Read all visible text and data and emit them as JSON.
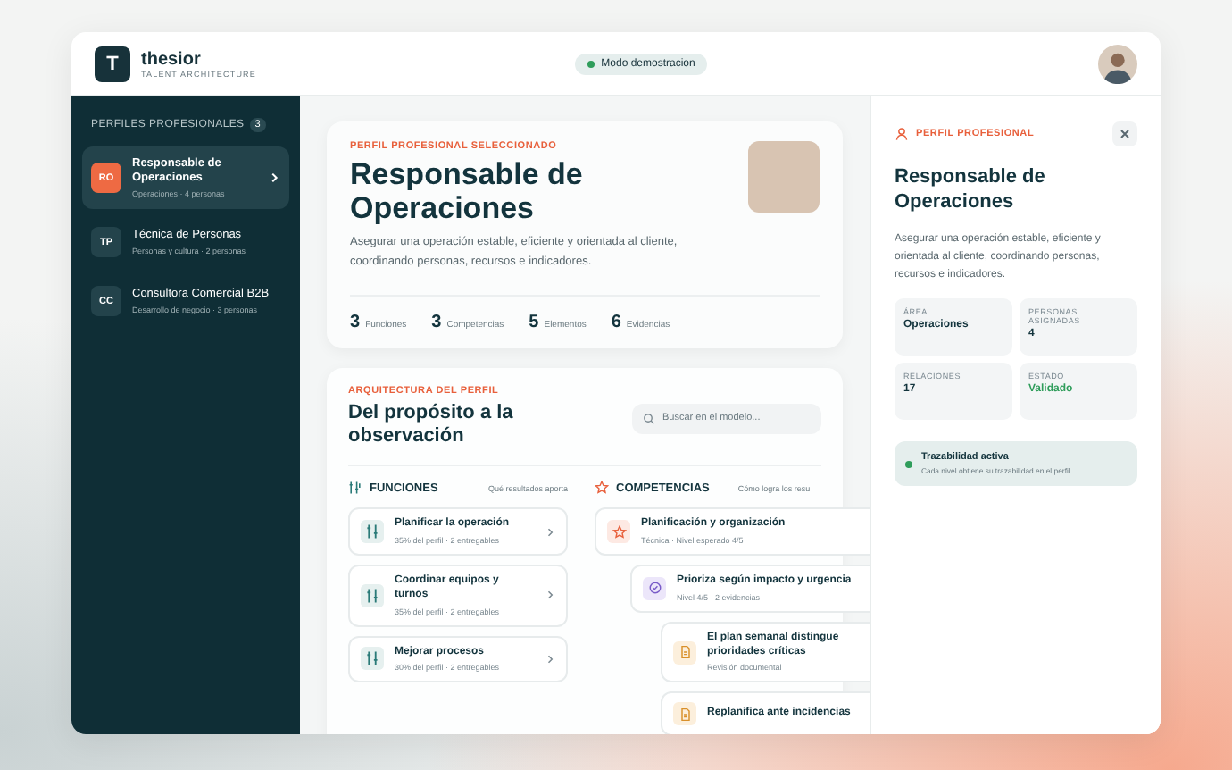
{
  "brand": {
    "logo_letter": "T",
    "name": "thesior",
    "tagline": "TALENT ARCHITECTURE"
  },
  "mode_badge": "Modo demostracion",
  "sidebar": {
    "heading": "PERFILES PROFESIONALES",
    "count": "3",
    "items": [
      {
        "initials": "RO",
        "title": "Responsable de Operaciones",
        "meta": "Operaciones · 4 personas",
        "selected": true
      },
      {
        "initials": "TP",
        "title": "Técnica de Personas",
        "meta": "Personas y cultura · 2 personas",
        "selected": false
      },
      {
        "initials": "CC",
        "title": "Consultora Comercial B2B",
        "meta": "Desarrollo de negocio · 3 personas",
        "selected": false
      }
    ]
  },
  "profile_card": {
    "eyebrow": "PERFIL PROFESIONAL SELECCIONADO",
    "title": "Responsable de Operaciones",
    "description": "Asegurar una operación estable, eficiente y orientada al cliente, coordinando personas, recursos e indicadores.",
    "stats": [
      {
        "value": "3",
        "label": "Funciones"
      },
      {
        "value": "3",
        "label": "Competencias"
      },
      {
        "value": "5",
        "label": "Elementos"
      },
      {
        "value": "6",
        "label": "Evidencias"
      }
    ]
  },
  "architecture": {
    "eyebrow": "ARQUITECTURA DEL PERFIL",
    "title": "Del propósito a la observación",
    "search": {
      "placeholder": "Buscar en el modelo..."
    },
    "functions": {
      "heading": "FUNCIONES",
      "hint": "Qué resultados aporta",
      "items": [
        {
          "title": "Planificar la operación",
          "meta": "35% del perfil · 2 entregables"
        },
        {
          "title": "Coordinar equipos y turnos",
          "meta": "35% del perfil · 2 entregables"
        },
        {
          "title": "Mejorar procesos",
          "meta": "30% del perfil · 2 entregables"
        }
      ]
    },
    "competencies": {
      "heading": "COMPETENCIAS",
      "hint": "Cómo logra los resu",
      "items": [
        {
          "kind": "competencia",
          "title": "Planificación y organización",
          "meta": "Técnica · Nivel esperado 4/5",
          "children": [
            {
              "kind": "conducta",
              "title": "Prioriza según impacto y urgencia",
              "meta": "Nivel 4/5 · 2 evidencias",
              "children": [
                {
                  "kind": "evidencia",
                  "title": "El plan semanal distingue prioridades críticas",
                  "meta": "Revisión documental"
                },
                {
                  "kind": "evidencia",
                  "title": "Replanifica ante incidencias"
                }
              ]
            }
          ]
        }
      ]
    }
  },
  "detail_panel": {
    "eyebrow": "PERFIL PROFESIONAL",
    "title": "Responsable de Operaciones",
    "description": "Asegurar una operación estable, eficiente y orientada al cliente, coordinando personas, recursos e indicadores.",
    "facts": [
      {
        "label": "ÁREA",
        "value": "Operaciones",
        "kind": "plain"
      },
      {
        "label": "PERSONAS ASIGNADAS",
        "value": "4",
        "kind": "plain"
      },
      {
        "label": "RELACIONES",
        "value": "17",
        "kind": "plain"
      },
      {
        "label": "ESTADO",
        "value": "Validado",
        "kind": "status"
      }
    ],
    "trace": {
      "title": "Trazabilidad activa",
      "text": "Cada nivel obtiene su trazabilidad en el perfil"
    }
  }
}
